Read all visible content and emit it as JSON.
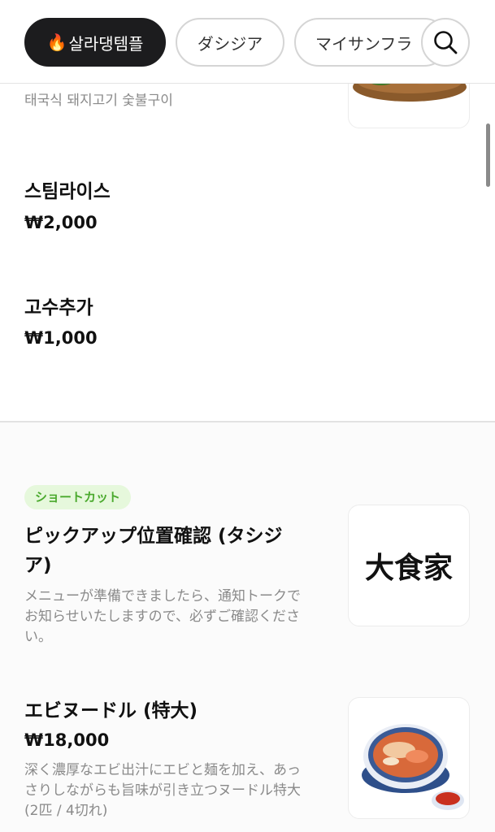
{
  "tabs": [
    {
      "label": "살라댕템플",
      "icon": "fire-icon",
      "active": true
    },
    {
      "label": "ダシジア",
      "active": false
    },
    {
      "label": "マイサンフラ",
      "active": false
    }
  ],
  "search_icon": "search-icon",
  "menu_items": [
    {
      "description": "태국식 돼지고기 숯불구이",
      "image_icon": "grilled-pork-dish-image"
    },
    {
      "name": "스팀라이스",
      "price": "₩2,000"
    },
    {
      "name": "고수추가",
      "price": "₩1,000"
    }
  ],
  "shortcut_section": {
    "badge": "ショートカット",
    "items": [
      {
        "name": "ピックアップ位置確認 (タシジア)",
        "description": "メニューが準備できましたら、通知トークでお知らせいたしますので、必ずご確認ください。",
        "logo_text": "大食家"
      },
      {
        "name": "エビヌードル (特大)",
        "price": "₩18,000",
        "description": "深く濃厚なエビ出汁にエビと麺を加え、あっさりしながらも旨味が引き立つヌードル特大 (2匹 / 4切れ)",
        "image_icon": "shrimp-noodle-bowl-image"
      }
    ]
  },
  "colors": {
    "active_tab_bg": "#1c1c1e",
    "badge_bg": "#e6f8dc",
    "badge_text": "#4aa92d",
    "muted_text": "#8a8a8a"
  }
}
